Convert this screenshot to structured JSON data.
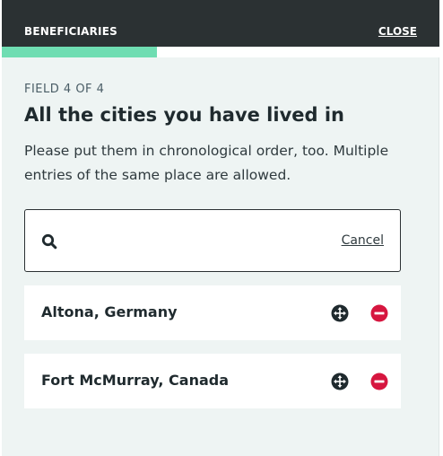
{
  "header": {
    "title": "BENEFICIARIES",
    "close_label": "CLOSE"
  },
  "progress": {
    "fraction": 0.355,
    "fill_color": "#6fddb2"
  },
  "form": {
    "field_label": "FIELD 4 OF 4",
    "question": "All the cities you have lived in",
    "helper_text": "Please put them in chronological order, too. Multiple entries of the same place are allowed."
  },
  "search": {
    "value": "",
    "placeholder": "",
    "icon": "search-icon",
    "cancel_label": "Cancel"
  },
  "items": [
    {
      "label": "Altona, Germany",
      "move_icon": "move-icon",
      "remove_icon": "remove-icon"
    },
    {
      "label": "Fort McMurray, Canada",
      "move_icon": "move-icon",
      "remove_icon": "remove-icon"
    }
  ],
  "colors": {
    "header_bg": "#2b3133",
    "accent": "#6fddb2",
    "remove": "#d6163f",
    "panel_bg": "#eef4f3"
  }
}
